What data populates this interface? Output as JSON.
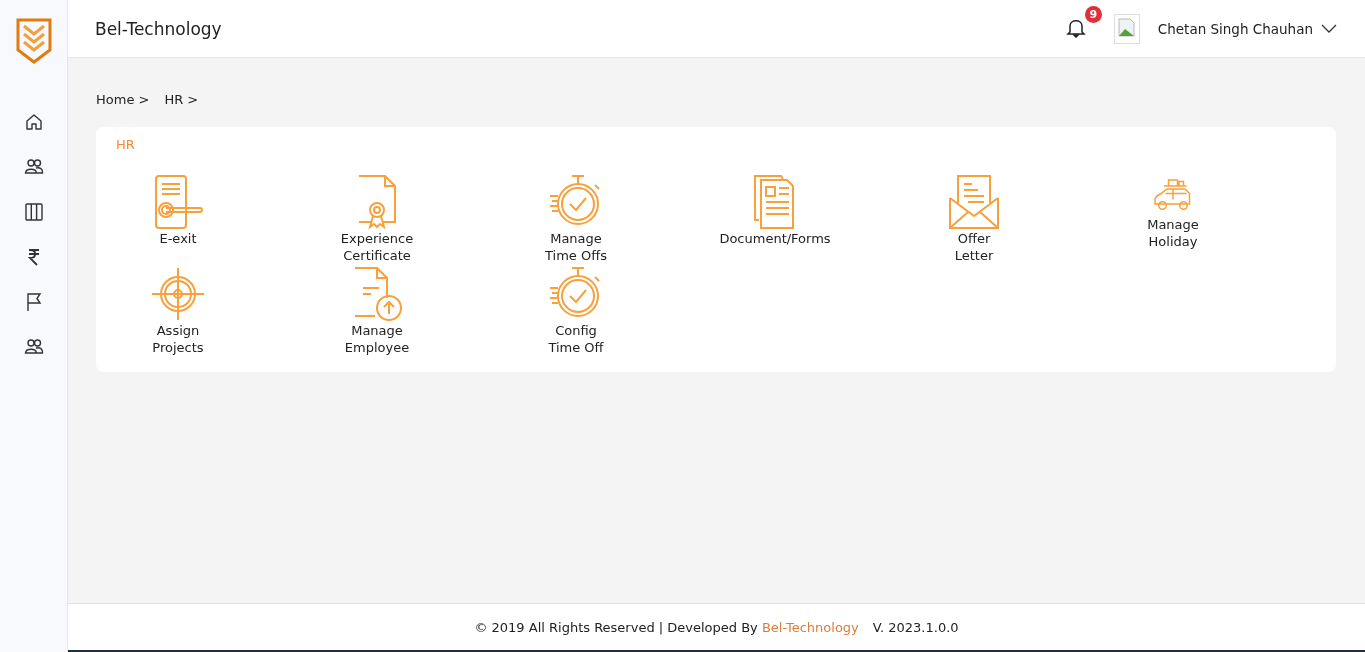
{
  "header": {
    "title": "Bel-Technology",
    "notifications": "9",
    "user": "Chetan Singh Chauhan"
  },
  "sidebar": {
    "items": [
      {
        "kind": "home"
      },
      {
        "kind": "users"
      },
      {
        "kind": "columns"
      },
      {
        "kind": "rupee"
      },
      {
        "kind": "flag"
      },
      {
        "kind": "users"
      }
    ]
  },
  "breadcrumb": [
    "Home >",
    "HR >"
  ],
  "panel": {
    "title": "HR",
    "tiles": [
      {
        "kind": "door-lock",
        "lines": [
          "E-exit"
        ]
      },
      {
        "kind": "certificate",
        "lines": [
          "Experience",
          "Certificate"
        ]
      },
      {
        "kind": "stopwatch",
        "lines": [
          "Manage",
          "Time Offs"
        ]
      },
      {
        "kind": "documents",
        "lines": [
          "Document/Forms"
        ]
      },
      {
        "kind": "envelope",
        "lines": [
          "Offer",
          "Letter"
        ]
      },
      {
        "kind": "car",
        "lines": [
          "Manage",
          "Holiday"
        ]
      },
      {
        "kind": "target",
        "lines": [
          "Assign",
          "Projects"
        ]
      },
      {
        "kind": "upload-file",
        "lines": [
          "Manage",
          "Employee"
        ]
      },
      {
        "kind": "stopwatch",
        "lines": [
          "Config",
          "Time Off"
        ]
      }
    ]
  },
  "footer": {
    "text": "© 2019 All Rights Reserved | Developed By",
    "link": "Bel-Technology",
    "version": "V. 2023.1.0.0"
  }
}
